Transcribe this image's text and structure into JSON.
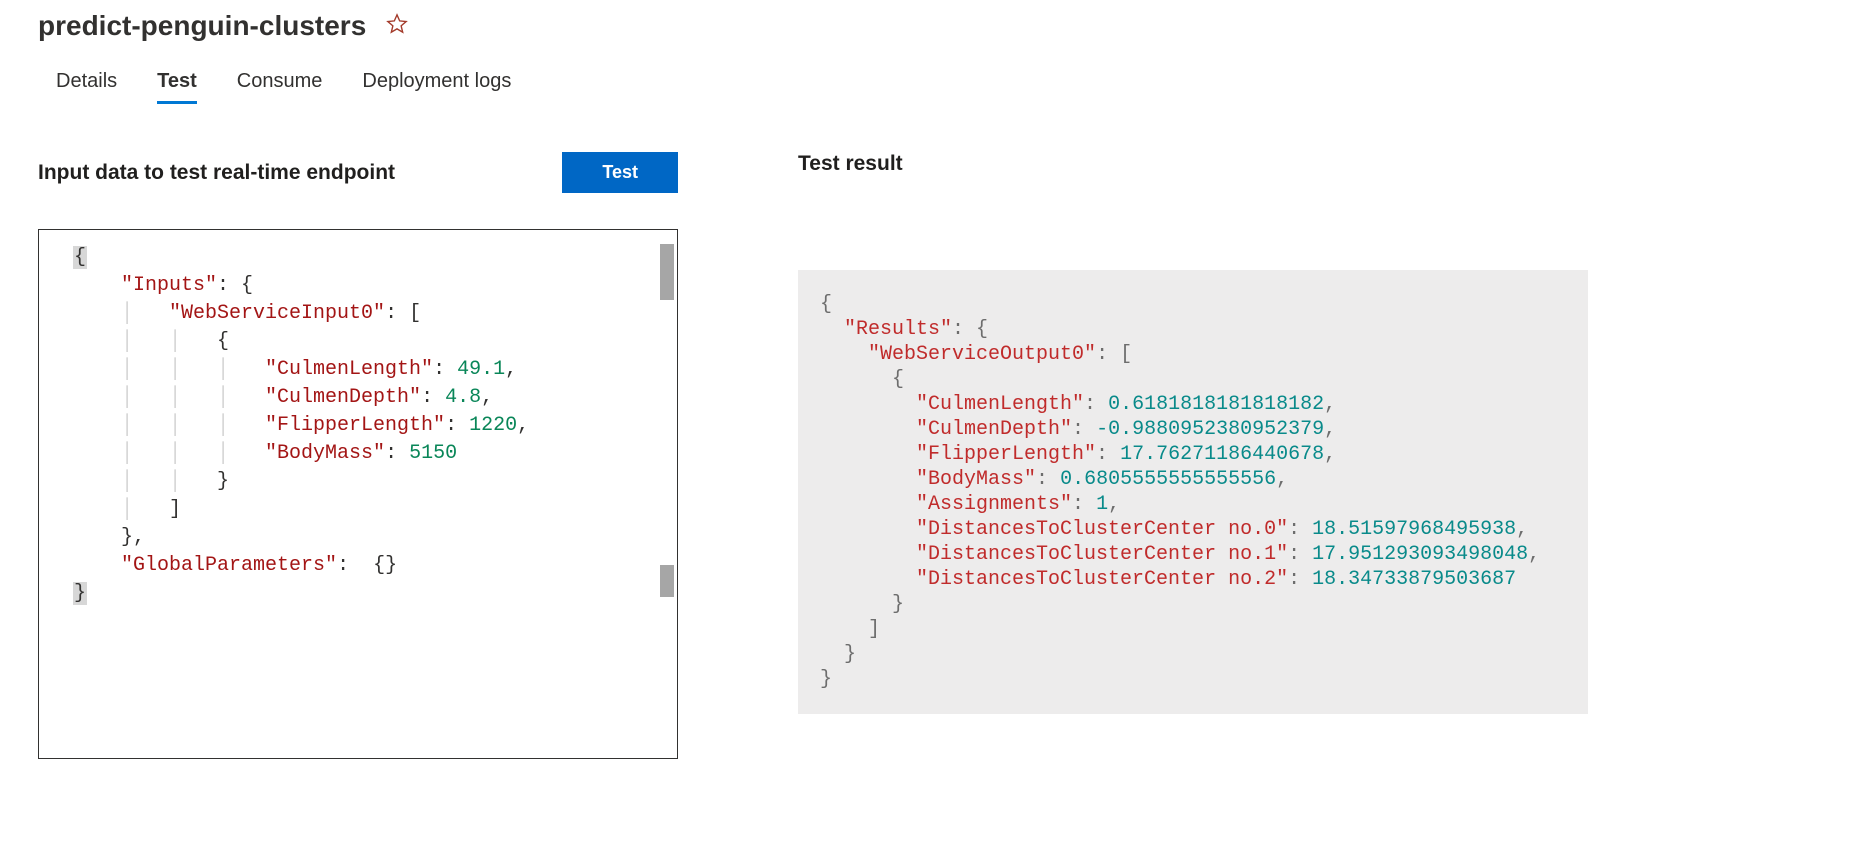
{
  "title": "predict-penguin-clusters",
  "tabs": {
    "details": "Details",
    "test": "Test",
    "consume": "Consume",
    "deployment_logs": "Deployment logs"
  },
  "left": {
    "header": "Input data to test real-time endpoint",
    "test_button": "Test",
    "code": {
      "brace_open": "{",
      "inputs_key": "\"Inputs\"",
      "wsi_key": "\"WebServiceInput0\"",
      "culmen_length_key": "\"CulmenLength\"",
      "culmen_length_val": "49.1",
      "culmen_depth_key": "\"CulmenDepth\"",
      "culmen_depth_val": "4.8",
      "flipper_length_key": "\"FlipperLength\"",
      "flipper_length_val": "1220",
      "body_mass_key": "\"BodyMass\"",
      "body_mass_val": "5150",
      "global_params_key": "\"GlobalParameters\"",
      "brace_close": "}"
    }
  },
  "right": {
    "header": "Test result",
    "code": {
      "results_key": "\"Results\"",
      "wso_key": "\"WebServiceOutput0\"",
      "culmen_length_key": "\"CulmenLength\"",
      "culmen_length_val": "0.6181818181818182",
      "culmen_depth_key": "\"CulmenDepth\"",
      "culmen_depth_val": "-0.9880952380952379",
      "flipper_length_key": "\"FlipperLength\"",
      "flipper_length_val": "17.76271186440678",
      "body_mass_key": "\"BodyMass\"",
      "body_mass_val": "0.6805555555555556",
      "assignments_key": "\"Assignments\"",
      "assignments_val": "1",
      "d0_key": "\"DistancesToClusterCenter no.0\"",
      "d0_val": "18.51597968495938",
      "d1_key": "\"DistancesToClusterCenter no.1\"",
      "d1_val": "17.951293093498048",
      "d2_key": "\"DistancesToClusterCenter no.2\"",
      "d2_val": "18.34733879503687"
    }
  }
}
